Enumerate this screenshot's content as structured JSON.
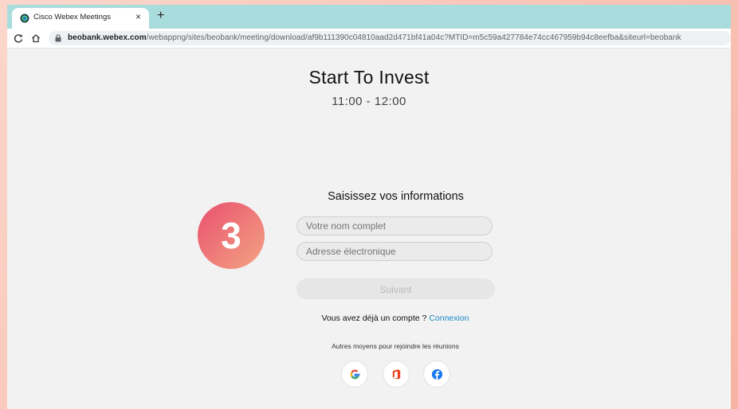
{
  "browser": {
    "tab": {
      "title": "Cisco Webex Meetings",
      "close": "×"
    },
    "new_tab": "+",
    "url": {
      "host": "beobank.webex.com",
      "path": "/webappng/sites/beobank/meeting/download/af9b111390c04810aad2d471bf41a04c?MTID=m5c59a427784e74cc467959b94c8eefba&siteurl=beobank"
    }
  },
  "meeting": {
    "title": "Start To Invest",
    "time": "11:00 - 12:00"
  },
  "form": {
    "heading": "Saisissez vos informations",
    "name_placeholder": "Votre nom complet",
    "email_placeholder": "Adresse électronique",
    "next_label": "Suivant",
    "account_prompt": "Vous avez déjà un compte ?",
    "login_link": "Connexion",
    "other_ways": "Autres moyens pour rejoindre les réunions"
  },
  "social": {
    "google_icon": "google-icon",
    "office_icon": "office-icon",
    "facebook_icon": "facebook-icon"
  },
  "step_badge": "3",
  "colors": {
    "tabbar": "#a9dcdc",
    "link": "#1a87c9",
    "badge_start": "#e8506e",
    "badge_end": "#f4a484",
    "background_start": "#fbd7cb",
    "background_end": "#f7b3a3"
  }
}
